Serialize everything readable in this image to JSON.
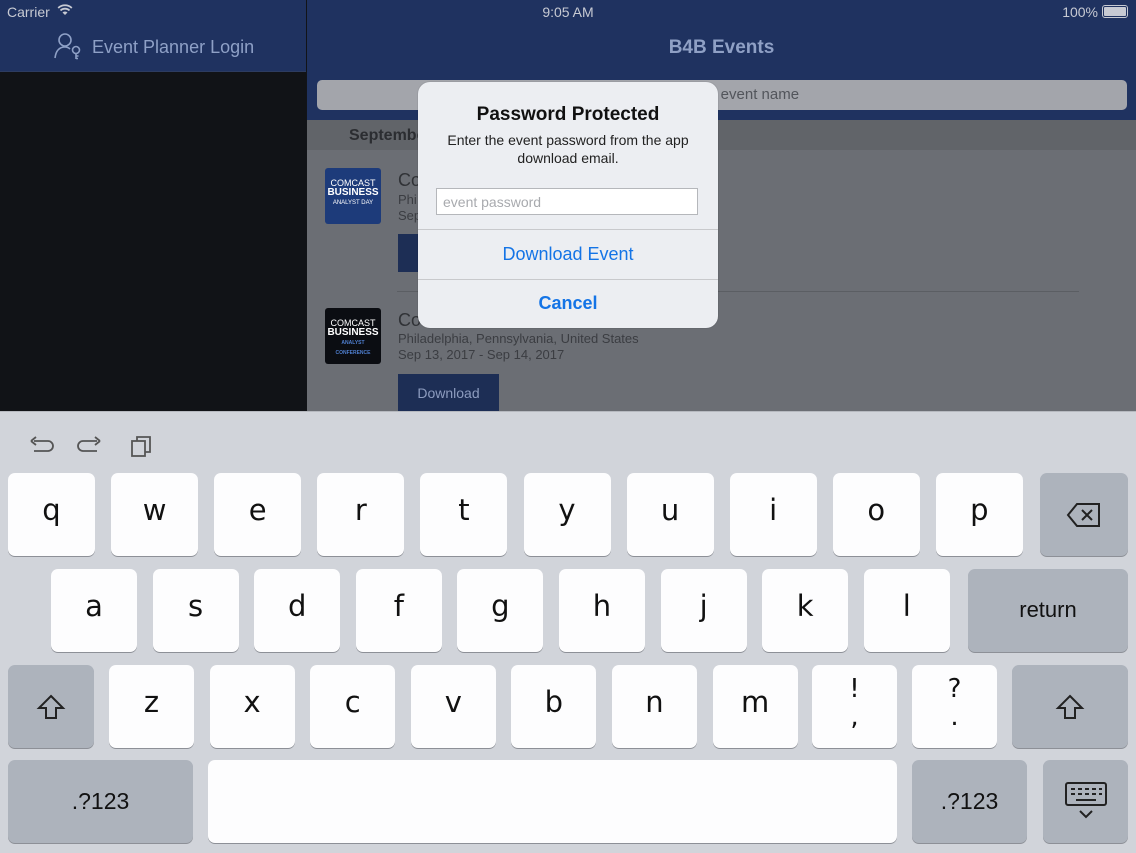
{
  "status_bar": {
    "carrier": "Carrier",
    "time": "9:05 AM",
    "battery": "100%"
  },
  "sidebar": {
    "title": "Event Planner Login",
    "icon": "person-key-icon"
  },
  "main": {
    "title": "B4B Events",
    "search_placeholder": "y event name",
    "section_header": "September",
    "events": [
      {
        "name": "Co",
        "location": "Phi",
        "date": "Sep",
        "logo_line1": "COMCAST",
        "logo_line2": "BUSINESS",
        "logo_line3": "ANALYST DAY",
        "logo_bg": "#1d3b7a"
      },
      {
        "name": "Co",
        "location": "Philadelphia, Pennsylvania, United States",
        "date": "Sep 13, 2017 - Sep 14, 2017",
        "logo_line1": "COMCAST",
        "logo_line2": "BUSINESS",
        "logo_line3": "ANALYST CONFERENCE",
        "logo_bg": "#0b0d12",
        "button": "Download"
      }
    ]
  },
  "alert": {
    "title": "Password Protected",
    "message": "Enter the event password from the app download email.",
    "input_placeholder": "event password",
    "primary_button": "Download Event",
    "cancel_button": "Cancel"
  },
  "keyboard": {
    "row1": [
      "q",
      "w",
      "e",
      "r",
      "t",
      "y",
      "u",
      "i",
      "o",
      "p"
    ],
    "row2": [
      "a",
      "s",
      "d",
      "f",
      "g",
      "h",
      "j",
      "k",
      "l"
    ],
    "row3": [
      "z",
      "x",
      "c",
      "v",
      "b",
      "n",
      "m"
    ],
    "punct1_top": "!",
    "punct1_bottom": ",",
    "punct2_top": "?",
    "punct2_bottom": ".",
    "return_label": "return",
    "numbers_label": ".?123"
  },
  "colors": {
    "accent": "#1474e6",
    "nav_bar": "#1f3260",
    "keyboard_bg": "#d1d4da"
  }
}
